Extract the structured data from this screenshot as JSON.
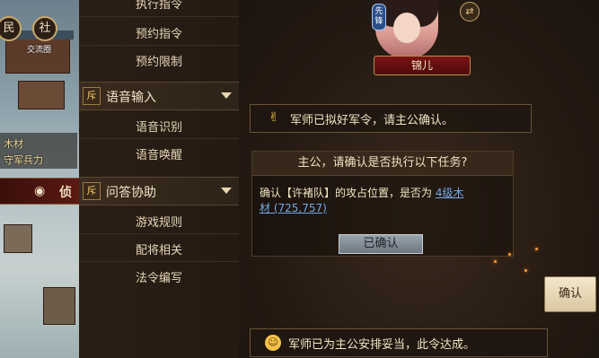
{
  "map": {
    "btn_min": "民",
    "btn_she": "社",
    "btn_she_caption": "交流圈",
    "resource_label": "木材",
    "garrison_label": "守军兵力",
    "spy_label": "侦"
  },
  "menu": {
    "items_top": [
      "执行指令",
      "预约指令",
      "预约限制"
    ],
    "section_voice": "语音输入",
    "items_voice": [
      "语音识别",
      "语音唤醒"
    ],
    "section_qa": "问答协助",
    "items_qa": [
      "游戏规则",
      "配将相关",
      "法令编写"
    ],
    "section_icon": "斥"
  },
  "chat": {
    "vanguard_badge": "先锋",
    "general_name": "锦儿",
    "msg1_icon": "✌",
    "msg1": "军师已拟好军令，请主公确认。",
    "task_title": "主公，请确认是否执行以下任务?",
    "task_prefix": "确认【许褚队】的攻占位置，是否为",
    "task_link_a": "4级木",
    "task_link_b": "材 (725,757)",
    "confirmed_label": "已确认",
    "confirm_button": "确认",
    "msg2_icon": "☺",
    "msg2": "军师已为主公安排妥当，此令达成。"
  }
}
